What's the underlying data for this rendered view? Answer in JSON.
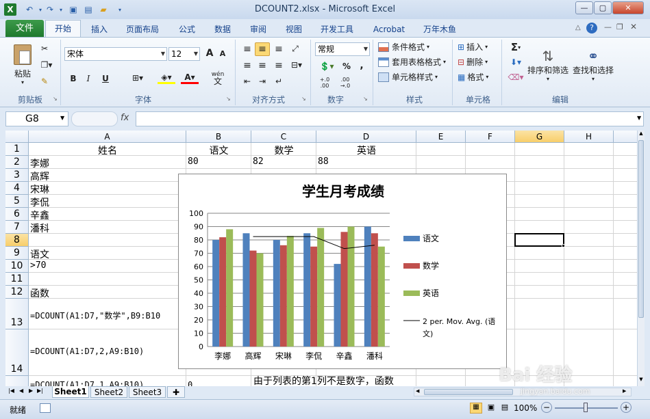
{
  "window": {
    "title": "DCOUNT2.xlsx - Microsoft Excel"
  },
  "tabs": [
    "文件",
    "开始",
    "插入",
    "页面布局",
    "公式",
    "数据",
    "审阅",
    "视图",
    "开发工具",
    "Acrobat",
    "万年木鱼"
  ],
  "ribbon": {
    "clipboard": {
      "paste": "粘贴",
      "label": "剪贴板"
    },
    "font": {
      "name": "宋体",
      "size": "12",
      "label": "字体",
      "bold": "B",
      "italic": "I",
      "underline": "U",
      "grow": "A",
      "shrink": "A",
      "color_a": "A",
      "wen": "wén",
      "wen2": "文"
    },
    "alignment": {
      "label": "对齐方式"
    },
    "number": {
      "format": "常规",
      "label": "数字",
      "percent": "%",
      "comma": ",",
      "inc": "+.0 .00",
      "dec": ".00 →.0"
    },
    "styles": {
      "conditional": "条件格式",
      "table": "套用表格格式",
      "cell": "单元格样式",
      "label": "样式"
    },
    "cells": {
      "insert": "插入",
      "delete": "删除",
      "format": "格式",
      "label": "单元格"
    },
    "editing": {
      "sum": "Σ",
      "sort": "排序和筛选",
      "find": "查找和选择",
      "label": "编辑"
    }
  },
  "formula_bar": {
    "name_box": "G8",
    "fx": "fx",
    "value": ""
  },
  "columns": [
    "A",
    "B",
    "C",
    "D",
    "E",
    "F",
    "G",
    "H"
  ],
  "rows": [
    "1",
    "2",
    "3",
    "4",
    "5",
    "6",
    "7",
    "8",
    "9",
    "10",
    "11",
    "12",
    "13",
    "14"
  ],
  "cells": {
    "A1": "姓名",
    "B1": "语文",
    "C1": "数学",
    "D1": "英语",
    "A2": "李娜",
    "B2": "80",
    "C2": "82",
    "D2": "88",
    "A3": "高辉",
    "A4": "宋琳",
    "A5": "李侃",
    "A6": "辛鑫",
    "A7": "潘科",
    "A9": "语文",
    "A10": ">70",
    "A12": "函数",
    "A13": "=DCOUNT(A1:D7,\"数学\",B9:B10",
    "A14": "=DCOUNT(A1:D7,2,A9:B10)",
    "A15": "=DCOUNT(A1:D7,1,A9:B10)",
    "B15": "0",
    "C15": "由于列表的第1列不是数字，函数"
  },
  "chart_data": {
    "type": "bar",
    "title": "学生月考成绩",
    "categories": [
      "李娜",
      "高辉",
      "宋琳",
      "李侃",
      "辛鑫",
      "潘科"
    ],
    "series": [
      {
        "name": "语文",
        "color": "#4f81bd",
        "values": [
          80,
          85,
          80,
          85,
          62,
          90
        ]
      },
      {
        "name": "数学",
        "color": "#c0504d",
        "values": [
          82,
          72,
          76,
          75,
          86,
          85
        ]
      },
      {
        "name": "英语",
        "color": "#9bbb59",
        "values": [
          88,
          70,
          83,
          89,
          90,
          75
        ]
      }
    ],
    "trendline": {
      "name": "2 per. Mov. Avg. (语文)",
      "values": [
        null,
        82.5,
        82.5,
        82.5,
        73.5,
        76
      ]
    },
    "ylim": [
      0,
      100
    ],
    "yticks": [
      "0",
      "10",
      "20",
      "30",
      "40",
      "50",
      "60",
      "70",
      "80",
      "90",
      "100"
    ],
    "legend": "right",
    "grid": true
  },
  "sheets": [
    "Sheet1",
    "Sheet2",
    "Sheet3"
  ],
  "status": {
    "ready": "就绪",
    "zoom": "100%"
  },
  "watermark": {
    "text": "Bai 经验",
    "url": "jingyan.baidu.com"
  }
}
